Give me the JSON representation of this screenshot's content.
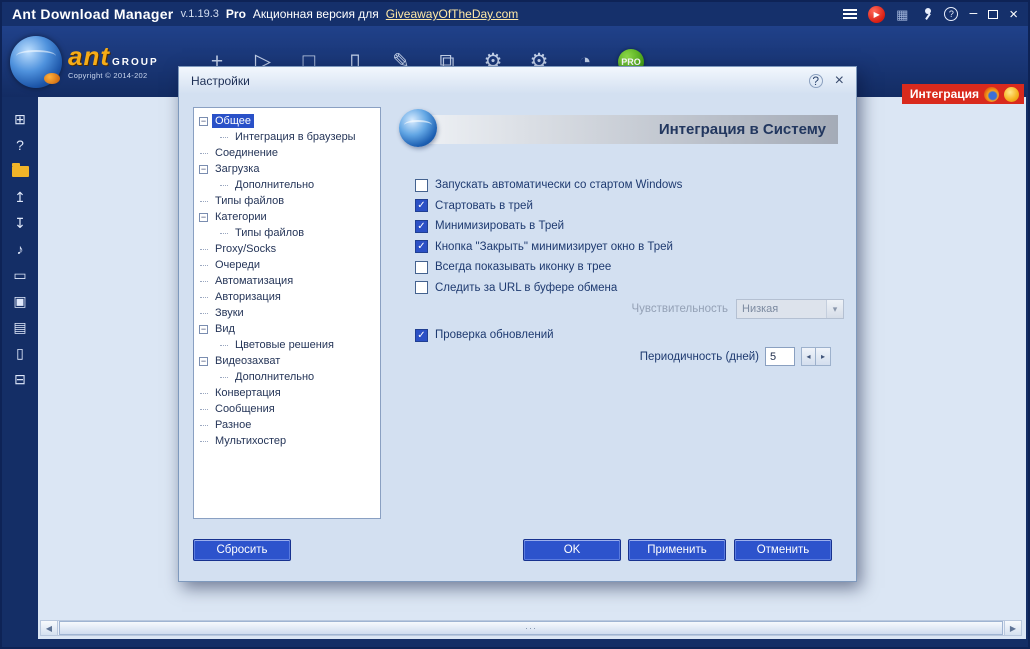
{
  "glyphs": {
    "check": "✓",
    "collapse": "−",
    "dropdown": "▾",
    "spin_left": "◂",
    "spin_right": "▸",
    "scroll_left": "◀",
    "scroll_right": "▶",
    "grip": "···",
    "help": "?",
    "close": "×",
    "minimize": "–",
    "grid": "▦",
    "promo_play": "▶"
  },
  "titlebar": {
    "title": "Ant Download Manager",
    "version": "v.1.19.3",
    "edition": "Pro",
    "promo_text": "Акционная версия для",
    "promo_link": "GiveawayOfTheDay.com"
  },
  "branding": {
    "name": "ant",
    "group": "GROUP",
    "copyright": "Copyright © 2014-202"
  },
  "toolbar": {
    "integration_label": "Интеграция",
    "icons": [
      {
        "name": "add-url-icon",
        "glyph": "+",
        "bee": true
      },
      {
        "name": "start-downloads-icon",
        "glyph": "▷"
      },
      {
        "name": "stop-downloads-icon",
        "glyph": "□"
      },
      {
        "name": "delete-icon",
        "glyph": "▯"
      },
      {
        "name": "edit-icon",
        "glyph": "✎"
      },
      {
        "name": "copy-icon",
        "glyph": "⧉"
      },
      {
        "name": "settings-icon",
        "glyph": "⚙"
      },
      {
        "name": "scheduler-icon",
        "glyph": "⚙"
      },
      {
        "name": "speed-limit-icon",
        "glyph": "◔"
      },
      {
        "name": "pro-badge",
        "glyph": "PRO"
      }
    ]
  },
  "sidebar": {
    "icons": [
      {
        "name": "categories-icon",
        "glyph": "⊞"
      },
      {
        "name": "help-icon",
        "glyph": "?"
      },
      {
        "name": "folder-icon",
        "style": "folder-shape"
      },
      {
        "name": "export-icon",
        "glyph": "↥"
      },
      {
        "name": "import-icon",
        "glyph": "↧"
      },
      {
        "name": "sounds-icon",
        "glyph": "♪"
      },
      {
        "name": "window-icon",
        "glyph": "▭"
      },
      {
        "name": "image-icon",
        "glyph": "▣"
      },
      {
        "name": "keyboard-icon",
        "glyph": "▤"
      },
      {
        "name": "document-icon",
        "glyph": "▯"
      },
      {
        "name": "printer-icon",
        "glyph": "⊟"
      }
    ]
  },
  "dialog": {
    "title": "Настройки",
    "tree": [
      {
        "label": "Общее",
        "level": 0,
        "expandable": true,
        "selected": true
      },
      {
        "label": "Интеграция в браузеры",
        "level": 1
      },
      {
        "label": "Соединение",
        "level": 0
      },
      {
        "label": "Загрузка",
        "level": 0,
        "expandable": true
      },
      {
        "label": "Дополнительно",
        "level": 1
      },
      {
        "label": "Типы файлов",
        "level": 0
      },
      {
        "label": "Категории",
        "level": 0,
        "expandable": true
      },
      {
        "label": "Типы файлов",
        "level": 1
      },
      {
        "label": "Proxy/Socks",
        "level": 0
      },
      {
        "label": "Очереди",
        "level": 0
      },
      {
        "label": "Автоматизация",
        "level": 0
      },
      {
        "label": "Авторизация",
        "level": 0
      },
      {
        "label": "Звуки",
        "level": 0
      },
      {
        "label": "Вид",
        "level": 0,
        "expandable": true
      },
      {
        "label": "Цветовые решения",
        "level": 1
      },
      {
        "label": "Видеозахват",
        "level": 0,
        "expandable": true
      },
      {
        "label": "Дополнительно",
        "level": 1
      },
      {
        "label": "Конвертация",
        "level": 0
      },
      {
        "label": "Сообщения",
        "level": 0
      },
      {
        "label": "Разное",
        "level": 0
      },
      {
        "label": "Мультихостер",
        "level": 0
      }
    ],
    "section": {
      "header": "Интеграция в Систему",
      "checkboxes": [
        {
          "label": "Запускать автоматически со стартом Windows",
          "checked": false
        },
        {
          "label": "Стартовать в трей",
          "checked": true
        },
        {
          "label": "Минимизировать в Трей",
          "checked": true
        },
        {
          "label": "Кнопка \"Закрыть\" минимизирует окно в Трей",
          "checked": true
        },
        {
          "label": "Всегда показывать иконку в трее",
          "checked": false
        },
        {
          "label": "Следить за URL в буфере обмена",
          "checked": false
        }
      ],
      "sensitivity_label": "Чувствительность",
      "sensitivity_value": "Низкая",
      "updates_label": "Проверка обновлений",
      "updates_checked": true,
      "period_label": "Периодичность (дней)",
      "period_value": "5"
    },
    "buttons": {
      "reset": "Сбросить",
      "ok": "OK",
      "apply": "Применить",
      "cancel": "Отменить"
    }
  },
  "colors": {
    "accent_blue": "#2d53cc",
    "titlebar_navy": "#15306b",
    "selection_blue": "#2a51c8",
    "badge_red": "#d92a1d",
    "pro_green": "#45a013",
    "folder_yellow": "#f0b429"
  }
}
